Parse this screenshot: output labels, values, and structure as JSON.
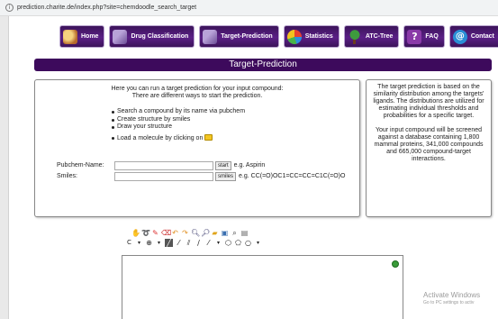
{
  "browser": {
    "url": "prediction.charite.de/index.php?site=chemdoodle_search_target"
  },
  "nav": {
    "items": [
      {
        "label": "Home",
        "icon": "home-icon",
        "color": "#d9a35a"
      },
      {
        "label": "Drug Classification",
        "icon": "pills-icon",
        "color": "#8a6fb0"
      },
      {
        "label": "Target-Prediction",
        "icon": "target-icon",
        "color": "#8a6fb0"
      },
      {
        "label": "Statistics",
        "icon": "pie-chart-icon",
        "color": "#f2b51f"
      },
      {
        "label": "ATC-Tree",
        "icon": "tree-icon",
        "color": "#2f7a2f"
      },
      {
        "label": "FAQ",
        "icon": "question-icon",
        "color": "#8a3aa8"
      },
      {
        "label": "Contact",
        "icon": "at-icon",
        "color": "#2a8fd6"
      }
    ]
  },
  "page": {
    "title": "Target-Prediction"
  },
  "main": {
    "intro_line1": "Here you can run a target prediction for your input compound:",
    "intro_line2": "There are different ways to start the prediction.",
    "bullets": [
      "Search a compound by its name via pubchem",
      "Create structure by smiles",
      "Draw your structure",
      "Load a molecule by clicking on"
    ],
    "pubchem": {
      "label": "Pubchem-Name:",
      "value": "",
      "button": "start",
      "example": "e.g. Aspirin"
    },
    "smiles": {
      "label": "Smiles:",
      "value": "",
      "button": "smiles",
      "example": "e.g. CC(=O)OC1=CC=CC=C1C(=O)O"
    }
  },
  "side": {
    "para1": "The target prediction is based on the similarity distribution among the targets' ligands. The distributions are utilized for estimating individual thresholds and probabilities for a specific target.",
    "para2": "Your input compound will be screened against a database containing 1,800 mammal proteins, 341,000 compounds and 665,000 compound-target interactions."
  },
  "watermark": {
    "line1": "Activate Windows",
    "line2": "Go to PC settings to activ"
  }
}
